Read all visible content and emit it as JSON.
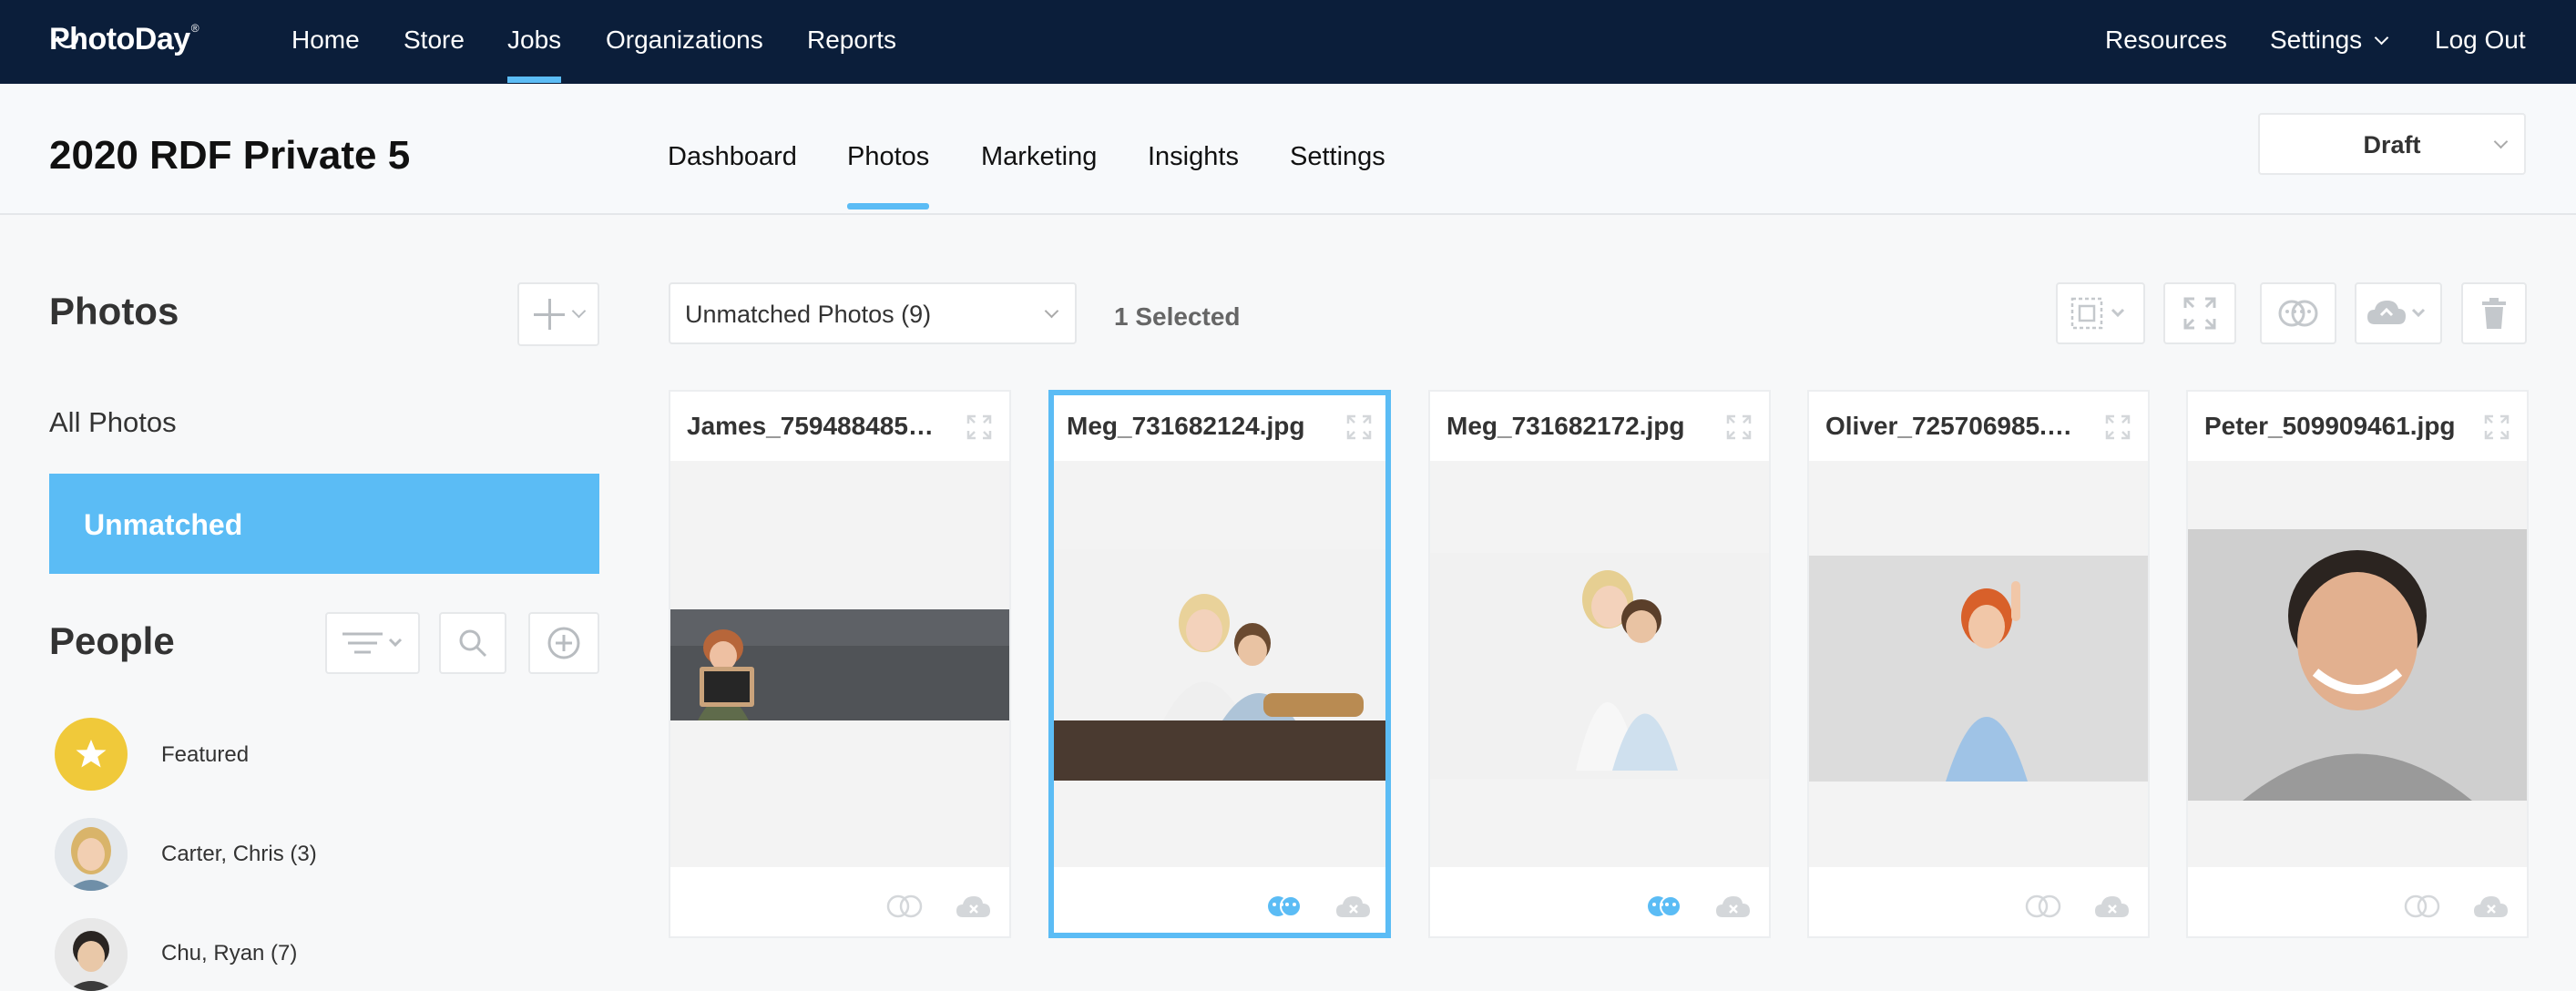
{
  "app": {
    "logo_text": "PhotoDay",
    "logo_mark": "®"
  },
  "topnav": {
    "left": [
      "Home",
      "Store",
      "Jobs",
      "Organizations",
      "Reports"
    ],
    "right": {
      "resources": "Resources",
      "settings": "Settings",
      "logout": "Log Out"
    },
    "active": "Jobs"
  },
  "job": {
    "title": "2020 RDF Private 5",
    "tabs": [
      "Dashboard",
      "Photos",
      "Marketing",
      "Insights",
      "Settings"
    ],
    "active_tab": "Photos",
    "status": "Draft"
  },
  "sidebar": {
    "photos_heading": "Photos",
    "all_photos": "All Photos",
    "unmatched": "Unmatched",
    "people_heading": "People",
    "people": [
      {
        "name": "Featured"
      },
      {
        "name": "Carter, Chris (3)"
      },
      {
        "name": "Chu, Ryan (7)"
      }
    ]
  },
  "toolbar": {
    "filter_value": "Unmatched Photos (9)",
    "selected_text": "1 Selected"
  },
  "photos": [
    {
      "filename": "James_759488485…",
      "selected": false,
      "tagged": false
    },
    {
      "filename": "Meg_731682124.jpg",
      "selected": true,
      "tagged": true
    },
    {
      "filename": "Meg_731682172.jpg",
      "selected": false,
      "tagged": true
    },
    {
      "filename": "Oliver_725706985.…",
      "selected": false,
      "tagged": false
    },
    {
      "filename": "Peter_509909461.jpg",
      "selected": false,
      "tagged": false
    }
  ],
  "colors": {
    "navy": "#0b1e3a",
    "accent": "#5bbcf5",
    "star": "#f0c93a"
  }
}
